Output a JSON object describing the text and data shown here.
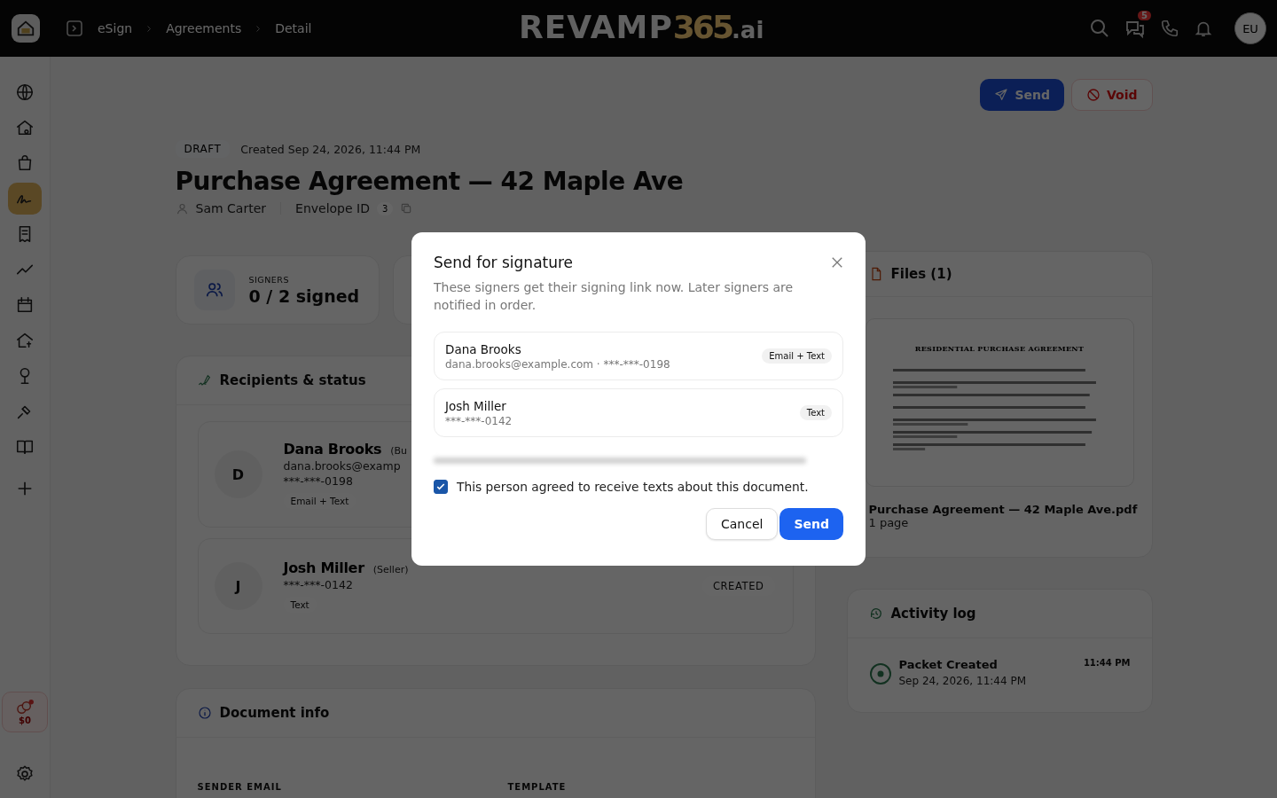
{
  "topbar": {
    "breadcrumbs": [
      {
        "label": "eSign"
      },
      {
        "label": "Agreements"
      },
      {
        "label": "Detail"
      }
    ],
    "logo": {
      "main": "REVAMP",
      "accent": "365",
      "suffix": ".ai"
    },
    "chat_badge": "5",
    "avatar": "EU"
  },
  "sidebar": {
    "items": [
      {
        "selected": false
      },
      {
        "selected": false
      },
      {
        "selected": false
      },
      {
        "selected": true
      },
      {
        "selected": false
      },
      {
        "selected": false
      },
      {
        "selected": false
      },
      {
        "selected": false
      },
      {
        "selected": false
      },
      {
        "selected": false
      },
      {
        "selected": false
      }
    ],
    "wallet": "$0"
  },
  "actions": [
    {
      "kind": "primary",
      "label": "Send"
    },
    {
      "kind": "danger",
      "label": "Void"
    }
  ],
  "header": {
    "status": "DRAFT",
    "created": "Created Sep 24, 2026, 11:44 PM",
    "title": "Purchase Agreement — 42 Maple Ave",
    "owner": "Sam Carter",
    "envelope_label": "Envelope ID",
    "envelope_id": "3"
  },
  "stats": [
    {
      "label": "SIGNERS",
      "value": "0 / 2 signed"
    }
  ],
  "recipients": {
    "title": "Recipients & status",
    "items": [
      {
        "initial": "D",
        "name": "Dana Brooks",
        "role": "(Bu",
        "contact": [
          "dana.brooks@examp",
          "***-***-0198"
        ],
        "channel": "Email + Text"
      },
      {
        "initial": "J",
        "name": "Josh Miller",
        "role": "(Seller)",
        "contact": [
          "***-***-0142"
        ],
        "channel": "Text",
        "status": "CREATED"
      }
    ]
  },
  "document_info": {
    "title": "Document info",
    "fields": [
      {
        "label": "SENDER EMAIL"
      },
      {
        "label": "TEMPLATE"
      }
    ]
  },
  "files": {
    "title": "Files (1)",
    "items": [
      {
        "preview_title": "RESIDENTIAL PURCHASE AGREEMENT",
        "name": "Purchase Agreement — 42 Maple Ave.pdf",
        "pages": "1 page"
      }
    ]
  },
  "activity": {
    "title": "Activity log",
    "events": [
      {
        "title": "Packet Created",
        "date": "Sep 24, 2026, 11:44 PM",
        "time": "11:44 PM"
      }
    ]
  },
  "dialog": {
    "title": "Send for signature",
    "description": "These signers get their signing link now. Later signers are notified in order.",
    "signers": [
      {
        "name": "Dana Brooks",
        "contact": "dana.brooks@example.com · ***-***-0198",
        "channel": "Email + Text"
      },
      {
        "name": "Josh Miller",
        "contact": "***-***-0142",
        "channel": "Text"
      }
    ],
    "consent": {
      "label": "This person agreed to receive texts about this document.",
      "checked": true
    },
    "buttons": [
      {
        "kind": "secondary",
        "label": "Cancel"
      },
      {
        "kind": "primary",
        "label": "Send"
      }
    ]
  }
}
